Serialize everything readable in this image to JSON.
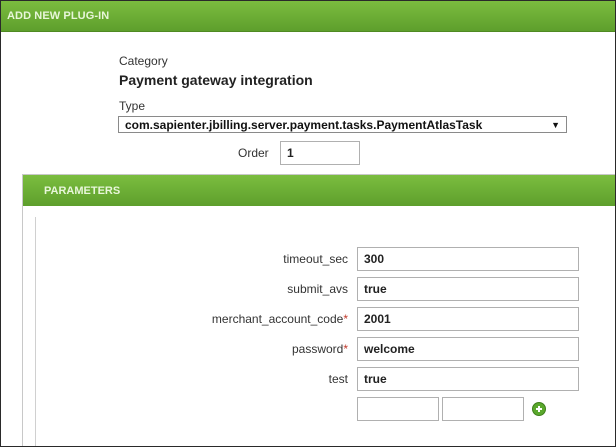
{
  "header": {
    "title": "ADD NEW PLUG-IN"
  },
  "category": {
    "label": "Category",
    "value": "Payment gateway integration"
  },
  "type": {
    "label": "Type",
    "selected": "com.sapienter.jbilling.server.payment.tasks.PaymentAtlasTask"
  },
  "order": {
    "label": "Order",
    "value": "1"
  },
  "parameters": {
    "title": "PARAMETERS",
    "items": [
      {
        "label": "timeout_sec",
        "value": "300",
        "required": false
      },
      {
        "label": "submit_avs",
        "value": "true",
        "required": false
      },
      {
        "label": "merchant_account_code",
        "value": "2001",
        "required": true
      },
      {
        "label": "password",
        "value": "welcome",
        "required": true
      },
      {
        "label": "test",
        "value": "true",
        "required": false
      }
    ],
    "required_mark": "*",
    "new_param": {
      "name": "",
      "value": ""
    }
  },
  "icons": {
    "add": "add-icon"
  },
  "colors": {
    "header_green": "#6aad34",
    "required": "#c0392b"
  }
}
